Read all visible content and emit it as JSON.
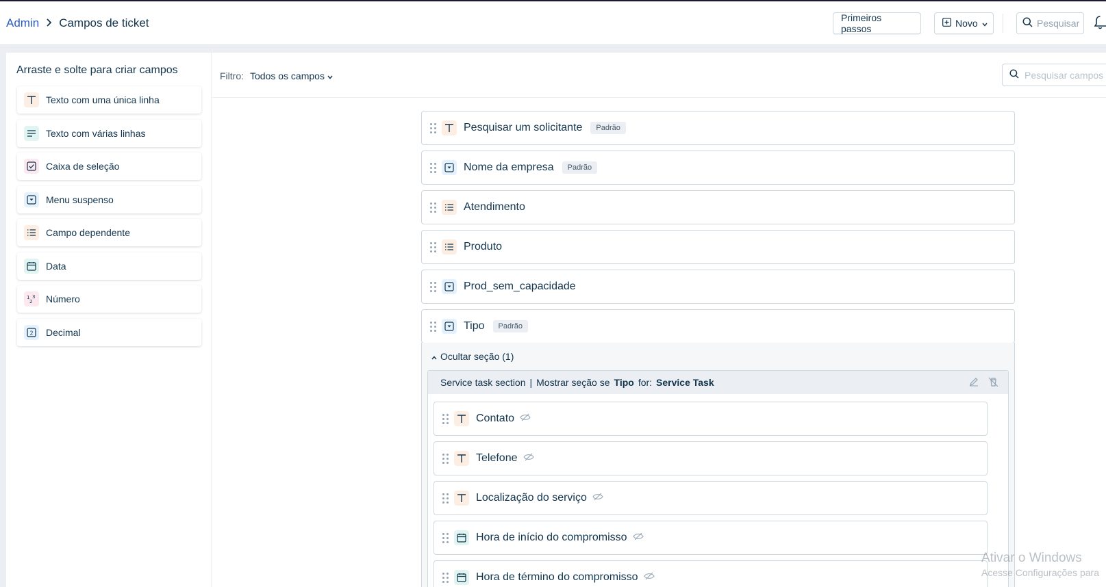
{
  "header": {
    "breadcrumb_root": "Admin",
    "breadcrumb_current": "Campos de ticket",
    "first_steps_label": "Primeiros passos",
    "new_label": "Novo",
    "search_placeholder": "Pesquisar"
  },
  "sidebar": {
    "title": "Arraste e solte para criar campos",
    "items": [
      {
        "label": "Texto com uma única linha",
        "icon": "text-icon"
      },
      {
        "label": "Texto com várias linhas",
        "icon": "paragraph-icon"
      },
      {
        "label": "Caixa de seleção",
        "icon": "checkbox-icon"
      },
      {
        "label": "Menu suspenso",
        "icon": "dropdown-icon"
      },
      {
        "label": "Campo dependente",
        "icon": "list-icon"
      },
      {
        "label": "Data",
        "icon": "calendar-icon"
      },
      {
        "label": "Número",
        "icon": "number-icon"
      },
      {
        "label": "Decimal",
        "icon": "decimal-icon"
      }
    ]
  },
  "filter": {
    "label": "Filtro:",
    "value": "Todos os campos",
    "search_placeholder": "Pesquisar campos"
  },
  "fields": [
    {
      "label": "Pesquisar um solicitante",
      "badge": "Padrão",
      "icon": "text-icon"
    },
    {
      "label": "Nome da empresa",
      "badge": "Padrão",
      "icon": "dropdown-icon"
    },
    {
      "label": "Atendimento",
      "badge": "",
      "icon": "list-icon"
    },
    {
      "label": "Produto",
      "badge": "",
      "icon": "list-icon"
    },
    {
      "label": "Prod_sem_capacidade",
      "badge": "",
      "icon": "dropdown-icon"
    },
    {
      "label": "Tipo",
      "badge": "Padrão",
      "icon": "dropdown-icon"
    }
  ],
  "section": {
    "toggle_label": "Ocultar seção (1)",
    "name": "Service task section",
    "separator": "|",
    "show_if_text": "Mostrar seção se",
    "condition_field": "Tipo",
    "for_text": "for:",
    "condition_value": "Service Task",
    "fields": [
      {
        "label": "Contato",
        "icon": "text-icon"
      },
      {
        "label": "Telefone",
        "icon": "text-icon"
      },
      {
        "label": "Localização do serviço",
        "icon": "text-icon"
      },
      {
        "label": "Hora de início do compromisso",
        "icon": "calendar-icon"
      },
      {
        "label": "Hora de término do compromisso",
        "icon": "calendar-icon"
      }
    ]
  },
  "watermark": {
    "line1": "Ativar o Windows",
    "line2": "Acesse Configurações para"
  },
  "colors": {
    "link": "#2c5cc5",
    "text": "#12344d",
    "background": "#ebeff3"
  }
}
